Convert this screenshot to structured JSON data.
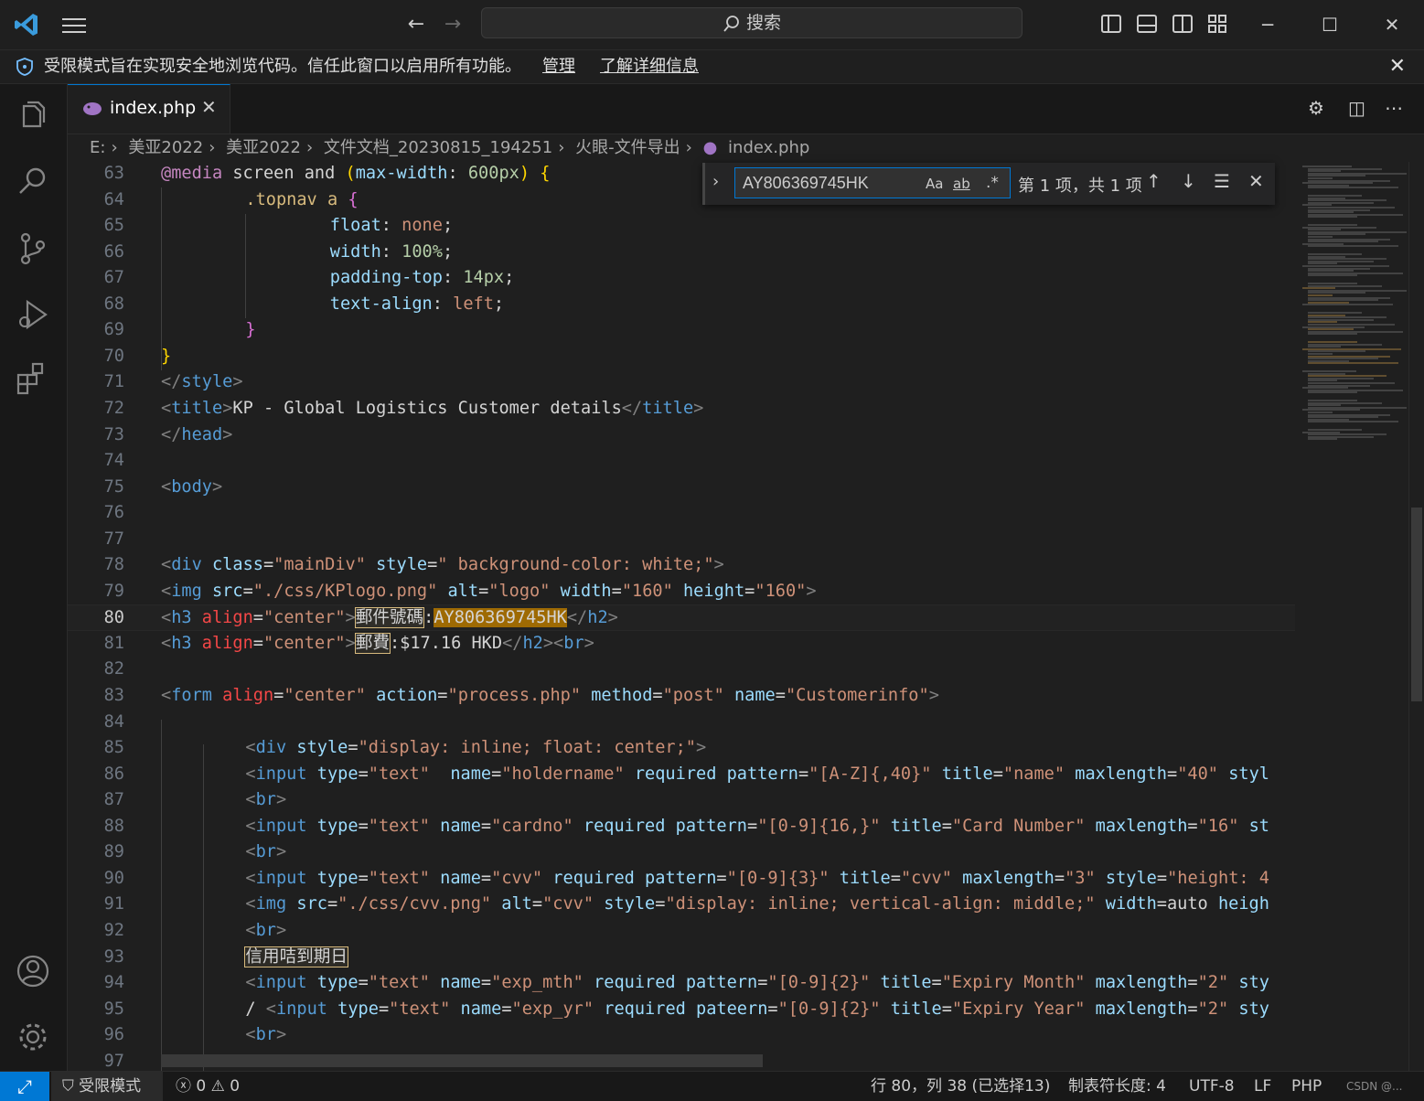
{
  "titlebar": {
    "search_label": "搜索",
    "back_icon": "arrow-left-icon",
    "forward_icon": "arrow-right-icon",
    "window_controls": [
      "minimize",
      "maximize",
      "close"
    ]
  },
  "banner": {
    "message": "受限模式旨在实现安全地浏览代码。信任此窗口以启用所有功能。",
    "manage_link": "管理",
    "learn_more_link": "了解详细信息",
    "close": "✕"
  },
  "tab": {
    "label": "index.php",
    "close": "✕"
  },
  "breadcrumb": [
    "E:",
    "美亚2022",
    "美亚2022",
    "文件文档_20230815_194251",
    "火眼-文件导出",
    "index.php"
  ],
  "find_widget": {
    "query": "AY806369745HK",
    "match_case": "Aa",
    "whole_word": "ab",
    "regex": ".*",
    "result": "第 1 项，共 1 项"
  },
  "editor": {
    "active_line": 80,
    "lines": [
      {
        "n": "63"
      },
      {
        "n": "64"
      },
      {
        "n": "65"
      },
      {
        "n": "66"
      },
      {
        "n": "67"
      },
      {
        "n": "68"
      },
      {
        "n": "69"
      },
      {
        "n": "70"
      },
      {
        "n": "71"
      },
      {
        "n": "72"
      },
      {
        "n": "73"
      },
      {
        "n": "74"
      },
      {
        "n": "75"
      },
      {
        "n": "76"
      },
      {
        "n": "77"
      },
      {
        "n": "78"
      },
      {
        "n": "79"
      },
      {
        "n": "80"
      },
      {
        "n": "81"
      },
      {
        "n": "82"
      },
      {
        "n": "83"
      },
      {
        "n": "84"
      },
      {
        "n": "85"
      },
      {
        "n": "86"
      },
      {
        "n": "87"
      },
      {
        "n": "88"
      },
      {
        "n": "89"
      },
      {
        "n": "90"
      },
      {
        "n": "91"
      },
      {
        "n": "92"
      },
      {
        "n": "93"
      },
      {
        "n": "94"
      },
      {
        "n": "95"
      },
      {
        "n": "96"
      },
      {
        "n": "97"
      }
    ],
    "code": {
      "l63": [
        "@media",
        " screen ",
        "and",
        " (",
        "max-width",
        ": ",
        "600px",
        ") ",
        "{"
      ],
      "l64": [
        ".topnav a ",
        "{"
      ],
      "l65": [
        "float",
        ": ",
        "none",
        ";"
      ],
      "l66": [
        "width",
        ": ",
        "100%",
        ";"
      ],
      "l67": [
        "padding-top",
        ": ",
        "14px",
        ";"
      ],
      "l68": [
        "text-align",
        ": ",
        "left",
        ";"
      ],
      "l69": [
        "}"
      ],
      "l70": [
        "}"
      ],
      "l71": [
        "</",
        "style",
        ">"
      ],
      "l72": [
        "<",
        "title",
        ">",
        "KP - Global Logistics Customer details",
        "</",
        "title",
        ">"
      ],
      "l73": [
        "</",
        "head",
        ">"
      ],
      "l75": [
        "<",
        "body",
        ">"
      ],
      "l78": [
        "<",
        "div",
        " class",
        "=",
        "\"mainDiv\"",
        " style",
        "=",
        "\" background-color: white;\"",
        ">"
      ],
      "l79": [
        "<",
        "img",
        " src",
        "=",
        "\"./css/KPlogo.png\"",
        " alt",
        "=",
        "\"logo\"",
        " width",
        "=",
        "\"160\"",
        " height",
        "=",
        "\"160\"",
        ">"
      ],
      "l80": [
        "<",
        "h3",
        " align",
        "=",
        "\"center\"",
        ">",
        "郵件號碼",
        ":",
        "AY806369745HK",
        "</",
        "h2",
        ">"
      ],
      "l81": [
        "<",
        "h3",
        " align",
        "=",
        "\"center\"",
        ">",
        "郵費",
        ":$17.16 HKD",
        "</",
        "h2",
        "><",
        "br",
        ">"
      ],
      "l83": [
        "<",
        "form",
        " align",
        "=",
        "\"center\"",
        " action",
        "=",
        "\"process.php\"",
        " method",
        "=",
        "\"post\"",
        " name",
        "=",
        "\"Customerinfo\"",
        ">"
      ],
      "l85": [
        "<",
        "div",
        " style",
        "=",
        "\"display: inline; float: center;\"",
        ">"
      ],
      "l86": [
        "<",
        "input",
        " type",
        "=",
        "\"text\"",
        "  name",
        "=",
        "\"holdername\"",
        " required",
        " pattern",
        "=",
        "\"[A-Z]{,40}\"",
        " title",
        "=",
        "\"name\"",
        " maxlength",
        "=",
        "\"40\"",
        " styl"
      ],
      "l87": [
        "<",
        "br",
        ">"
      ],
      "l88": [
        "<",
        "input",
        " type",
        "=",
        "\"text\"",
        " name",
        "=",
        "\"cardno\"",
        " required",
        " pattern",
        "=",
        "\"[0-9]{16,}\"",
        " title",
        "=",
        "\"Card Number\"",
        " maxlength",
        "=",
        "\"16\"",
        " st"
      ],
      "l89": [
        "<",
        "br",
        ">"
      ],
      "l90": [
        "<",
        "input",
        " type",
        "=",
        "\"text\"",
        " name",
        "=",
        "\"cvv\"",
        " required",
        " pattern",
        "=",
        "\"[0-9]{3}\"",
        " title",
        "=",
        "\"cvv\"",
        " maxlength",
        "=",
        "\"3\"",
        " style",
        "=",
        "\"height: 4"
      ],
      "l91": [
        "<",
        "img",
        " src",
        "=",
        "\"./css/cvv.png\"",
        " alt",
        "=",
        "\"cvv\"",
        " style",
        "=",
        "\"display: inline; vertical-align: middle;\"",
        " width",
        "=auto",
        " heigh"
      ],
      "l92": [
        "<",
        "br",
        ">"
      ],
      "l93": [
        "信用咭到期日"
      ],
      "l94": [
        "<",
        "input",
        " type",
        "=",
        "\"text\"",
        " name",
        "=",
        "\"exp_mth\"",
        " required",
        " pattern",
        "=",
        "\"[0-9]{2}\"",
        " title",
        "=",
        "\"Expiry Month\"",
        " maxlength",
        "=",
        "\"2\"",
        " sty"
      ],
      "l95": [
        "/ ",
        "<",
        "input",
        " type",
        "=",
        "\"text\"",
        " name",
        "=",
        "\"exp_yr\"",
        " required",
        " pateern",
        "=",
        "\"[0-9]{2}\"",
        " title",
        "=",
        "\"Expiry Year\"",
        " maxlength",
        "=",
        "\"2\"",
        " sty"
      ],
      "l96": [
        "<",
        "br",
        ">"
      ]
    }
  },
  "statusbar": {
    "restricted": "受限模式",
    "errors": "0",
    "warnings": "0",
    "cursor": "行 80，列 38 (已选择13)",
    "tab_size": "制表符长度: 4",
    "encoding": "UTF-8",
    "eol": "LF",
    "language": "PHP",
    "watermark": "CSDN @..."
  },
  "colors": {
    "accent": "#0078d4",
    "match_highlight": "#9e6a03",
    "editor_bg": "#1f1f1f"
  }
}
